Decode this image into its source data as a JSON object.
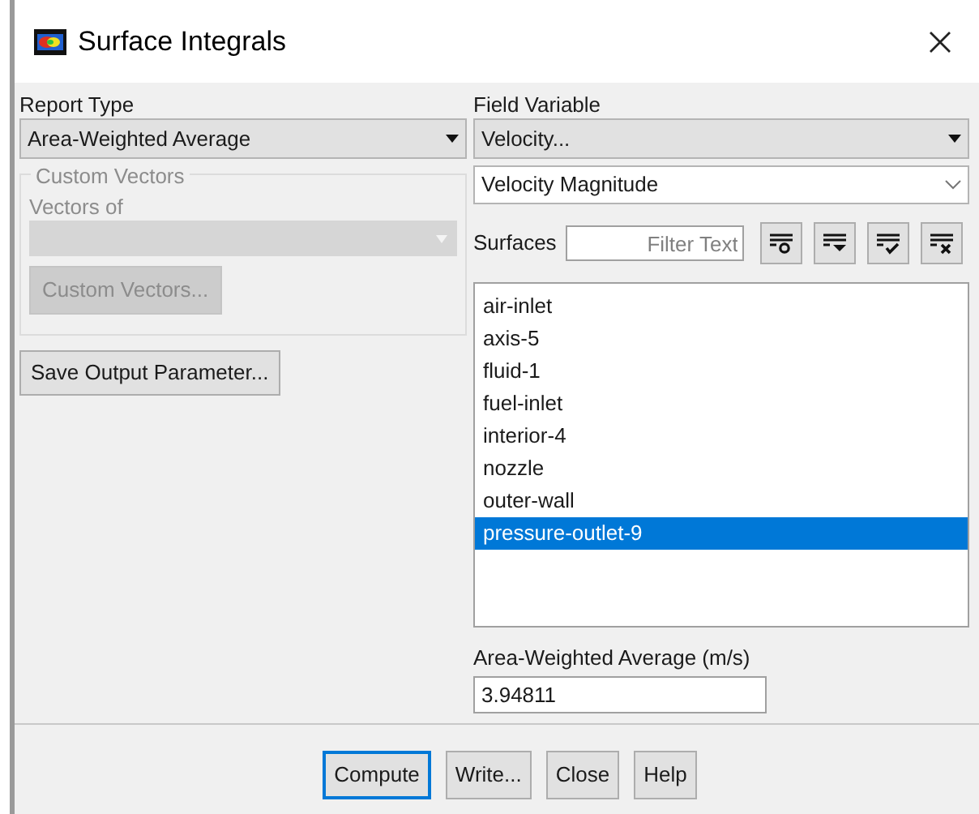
{
  "window": {
    "title": "Surface Integrals"
  },
  "report_type": {
    "label": "Report Type",
    "value": "Area-Weighted Average"
  },
  "custom_vectors": {
    "title": "Custom Vectors",
    "vectors_of_label": "Vectors of",
    "button": "Custom Vectors...",
    "disabled": true
  },
  "save_output_button": "Save Output Parameter...",
  "field_variable": {
    "label": "Field Variable",
    "value": "Velocity...",
    "sub_value": "Velocity Magnitude"
  },
  "surfaces": {
    "label": "Surfaces",
    "filter_placeholder": "Filter Text",
    "items": [
      {
        "label": "air-inlet",
        "selected": false
      },
      {
        "label": "axis-5",
        "selected": false
      },
      {
        "label": "fluid-1",
        "selected": false
      },
      {
        "label": "fuel-inlet",
        "selected": false
      },
      {
        "label": "interior-4",
        "selected": false
      },
      {
        "label": "nozzle",
        "selected": false
      },
      {
        "label": "outer-wall",
        "selected": false
      },
      {
        "label": "pressure-outlet-9",
        "selected": true
      }
    ]
  },
  "result": {
    "label": "Area-Weighted Average (m/s)",
    "value": "3.94811"
  },
  "buttons": [
    {
      "label": "Compute",
      "focused": true
    },
    {
      "label": "Write...",
      "focused": false
    },
    {
      "label": "Close",
      "focused": false
    },
    {
      "label": "Help",
      "focused": false
    }
  ]
}
